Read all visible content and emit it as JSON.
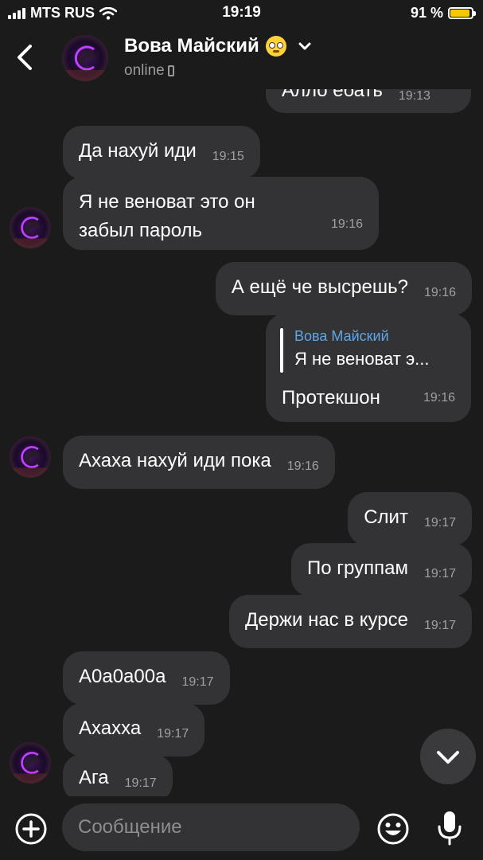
{
  "status_bar": {
    "carrier": "MTS RUS",
    "time": "19:19",
    "battery_percent": "91 %",
    "battery_level": 0.91,
    "battery_color": "#f7c800"
  },
  "header": {
    "contact_name": "Вова Майский",
    "name_emoji": "rolling-eyes-emoji",
    "status": "online"
  },
  "messages": [
    {
      "side": "out",
      "text": "Алло ебать",
      "time": "19:13",
      "partial": true
    },
    {
      "side": "in",
      "text": "Да нахуй иди",
      "time": "19:15"
    },
    {
      "side": "in",
      "text": "Я не веноват это он забыл пароль",
      "time": "19:16"
    },
    {
      "side": "out",
      "text": "А ещё че высрешь?",
      "time": "19:16"
    },
    {
      "side": "out",
      "reply_to_name": "Вова Майский",
      "reply_to_text": "Я не веноват э...",
      "text": "Протекшон",
      "time": "19:16"
    },
    {
      "side": "in",
      "text": "Ахаха нахуй иди пока",
      "time": "19:16"
    },
    {
      "side": "out",
      "text": "Слит",
      "time": "19:17"
    },
    {
      "side": "out",
      "text": "По группам",
      "time": "19:17"
    },
    {
      "side": "out",
      "text": "Держи нас в курсе",
      "time": "19:17"
    },
    {
      "side": "in",
      "text": "А0а0а00а",
      "time": "19:17"
    },
    {
      "side": "in",
      "text": "Ахахха",
      "time": "19:17"
    },
    {
      "side": "in",
      "text": "Ага",
      "time": "19:17"
    }
  ],
  "composer": {
    "placeholder": "Сообщение"
  },
  "colors": {
    "background": "#1b1b1b",
    "bubble": "#333335",
    "reply_accent": "#5ea6e6",
    "timestamp": "#a0a0a0"
  }
}
